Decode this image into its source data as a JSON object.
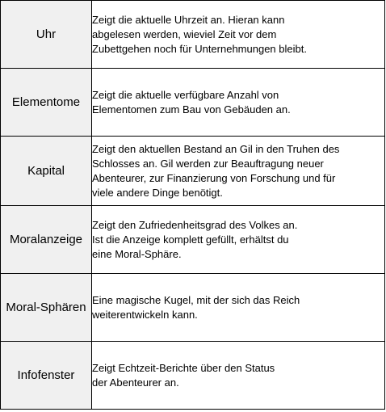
{
  "rows": [
    {
      "term": "Uhr",
      "description": "Zeigt die aktuelle Uhrzeit an. Hieran kann\nabgelesen werden, wieviel Zeit vor dem\nZubettgehen noch für Unternehmungen bleibt."
    },
    {
      "term": "Elementome",
      "description": "Zeigt die aktuelle verfügbare Anzahl von\nElementomen zum Bau von Gebäuden an."
    },
    {
      "term": "Kapital",
      "description": "Zeigt den aktuellen Bestand an Gil in den Truhen des\nSchlosses an. Gil werden zur Beauftragung neuer\nAbenteurer, zur Finanzierung von Forschung und für\nviele andere Dinge benötigt."
    },
    {
      "term": "Moralanzeige",
      "description": "Zeigt den Zufriedenheitsgrad des Volkes an.\nIst die Anzeige komplett gefüllt, erhältst du\neine Moral-Sphäre."
    },
    {
      "term": "Moral-Sphären",
      "description": "Eine magische Kugel, mit der sich das Reich\nweiterentwickeln kann."
    },
    {
      "term": "Infofenster",
      "description": "Zeigt Echtzeit-Berichte über den Status\nder Abenteurer an."
    }
  ]
}
